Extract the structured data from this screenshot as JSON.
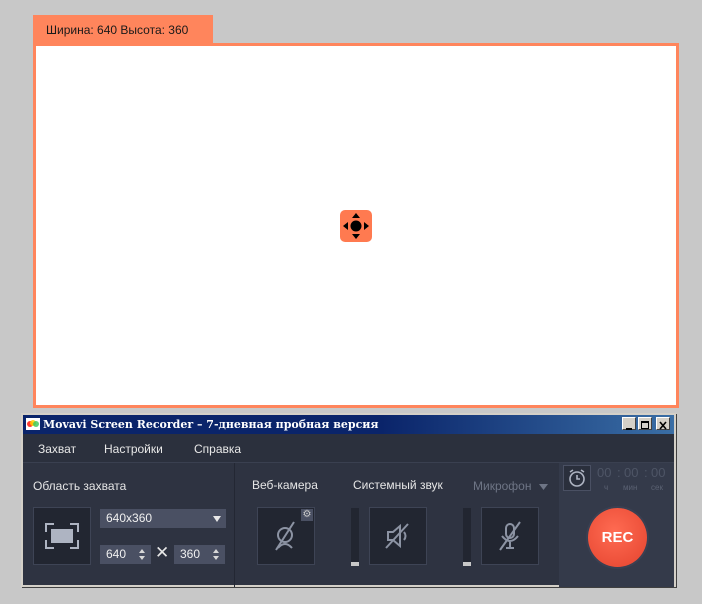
{
  "capture_frame": {
    "size_label": "Ширина: 640  Высота: 360"
  },
  "window": {
    "title": "Movavi Screen Recorder – 7-дневная пробная версия"
  },
  "menu": [
    "Захват",
    "Настройки",
    "Справка"
  ],
  "capture_area": {
    "label": "Область захвата",
    "preset": "640x360",
    "width": "640",
    "height": "360"
  },
  "webcam": {
    "label": "Веб-камера"
  },
  "system_audio": {
    "label": "Системный звук"
  },
  "microphone": {
    "label": "Микрофон"
  },
  "timer": {
    "hours": "00",
    "minutes": "00",
    "seconds": "00",
    "sep": ":",
    "unit_h": "ч",
    "unit_m": "мин",
    "unit_s": "сек"
  },
  "rec_label": "REC",
  "colors": {
    "frame_accent": "#ff855c",
    "panel_bg": "#2e3341",
    "rec_button": "#e94c35"
  },
  "icons": {
    "move": "move-arrows-icon",
    "fullscreen": "capture-area-icon",
    "webcam": "webcam-off-icon",
    "speaker": "speaker-muted-icon",
    "microphone": "microphone-muted-icon",
    "alarm": "alarm-clock-icon",
    "settings": "gear-icon"
  }
}
